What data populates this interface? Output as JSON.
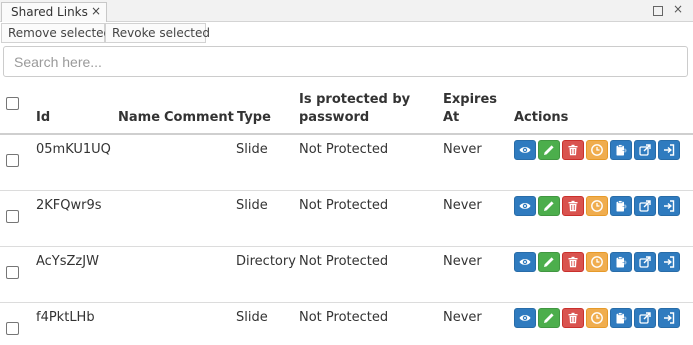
{
  "tab": {
    "title": "Shared Links",
    "close_glyph": "×"
  },
  "window": {
    "close_glyph": "×"
  },
  "toolbar": {
    "remove_label": "Remove selected",
    "revoke_label": "Revoke selected"
  },
  "search": {
    "placeholder": "Search here...",
    "value": ""
  },
  "table": {
    "headers": {
      "id": "Id",
      "name": "Name",
      "comment": "Comment",
      "type": "Type",
      "protected_line1": "Is protected by",
      "protected_line2": "password",
      "expires_line1": "Expires",
      "expires_line2": "At",
      "actions": "Actions"
    },
    "rows": [
      {
        "id": "05mKU1UQ",
        "name": "",
        "comment": "",
        "type": "Slide",
        "protected": "Not Protected",
        "expires": "Never"
      },
      {
        "id": "2KFQwr9s",
        "name": "",
        "comment": "",
        "type": "Slide",
        "protected": "Not Protected",
        "expires": "Never"
      },
      {
        "id": "AcYsZzJW",
        "name": "",
        "comment": "",
        "type": "Directory",
        "protected": "Not Protected",
        "expires": "Never"
      },
      {
        "id": "f4PktLHb",
        "name": "",
        "comment": "",
        "type": "Slide",
        "protected": "Not Protected",
        "expires": "Never"
      }
    ],
    "action_icons": [
      "eye-icon",
      "pencil-icon",
      "trash-icon",
      "clock-icon",
      "clipboard-icon",
      "external-link-icon",
      "sign-in-icon"
    ],
    "action_colors": {
      "view": "#2f7bbf",
      "edit": "#4cae4c",
      "delete": "#d9534f",
      "expiry": "#f0ad4e"
    }
  }
}
